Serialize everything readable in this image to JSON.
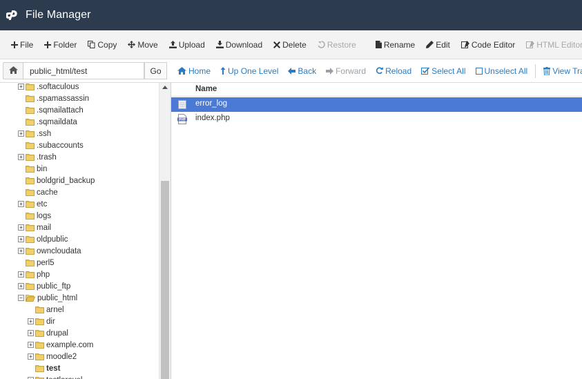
{
  "header": {
    "title": "File Manager",
    "logo_icon": "cpanel-logo-icon"
  },
  "toolbar": {
    "buttons": [
      {
        "label": "File",
        "icon": "plus-icon",
        "disabled": false
      },
      {
        "label": "Folder",
        "icon": "plus-icon",
        "disabled": false
      },
      {
        "label": "Copy",
        "icon": "copy-icon",
        "disabled": false
      },
      {
        "label": "Move",
        "icon": "move-icon",
        "disabled": false
      },
      {
        "label": "Upload",
        "icon": "upload-icon",
        "disabled": false
      },
      {
        "label": "Download",
        "icon": "download-icon",
        "disabled": false
      },
      {
        "label": "Delete",
        "icon": "delete-icon",
        "disabled": false
      },
      {
        "label": "Restore",
        "icon": "restore-icon",
        "disabled": true
      },
      {
        "label": "Rename",
        "icon": "rename-icon",
        "disabled": false
      },
      {
        "label": "Edit",
        "icon": "pencil-icon",
        "disabled": false
      },
      {
        "label": "Code Editor",
        "icon": "code-editor-icon",
        "disabled": false
      },
      {
        "label": "HTML Editor",
        "icon": "html-editor-icon",
        "disabled": true
      }
    ]
  },
  "navbar": {
    "path_value": "public_html/test",
    "go_label": "Go",
    "actions": [
      {
        "label": "Home",
        "icon": "home-icon",
        "disabled": false
      },
      {
        "label": "Up One Level",
        "icon": "level-up-icon",
        "disabled": false
      },
      {
        "label": "Back",
        "icon": "arrow-left-icon",
        "disabled": false
      },
      {
        "label": "Forward",
        "icon": "arrow-right-icon",
        "disabled": true
      },
      {
        "label": "Reload",
        "icon": "reload-icon",
        "disabled": false
      },
      {
        "label": "Select All",
        "icon": "select-all-icon",
        "disabled": false
      },
      {
        "label": "Unselect All",
        "icon": "unselect-all-icon",
        "disabled": false
      },
      {
        "label": "View Trash",
        "icon": "trash-icon",
        "disabled": false
      }
    ]
  },
  "tree": {
    "items": [
      {
        "label": ".softaculous",
        "depth": 0,
        "expander": "plus",
        "bold": false,
        "open": false
      },
      {
        "label": ".spamassassin",
        "depth": 0,
        "expander": "none",
        "bold": false,
        "open": false
      },
      {
        "label": ".sqmailattach",
        "depth": 0,
        "expander": "none",
        "bold": false,
        "open": false
      },
      {
        "label": ".sqmaildata",
        "depth": 0,
        "expander": "none",
        "bold": false,
        "open": false
      },
      {
        "label": ".ssh",
        "depth": 0,
        "expander": "plus",
        "bold": false,
        "open": false
      },
      {
        "label": ".subaccounts",
        "depth": 0,
        "expander": "none",
        "bold": false,
        "open": false
      },
      {
        "label": ".trash",
        "depth": 0,
        "expander": "plus",
        "bold": false,
        "open": false
      },
      {
        "label": "bin",
        "depth": 0,
        "expander": "none",
        "bold": false,
        "open": false
      },
      {
        "label": "boldgrid_backup",
        "depth": 0,
        "expander": "none",
        "bold": false,
        "open": false
      },
      {
        "label": "cache",
        "depth": 0,
        "expander": "none",
        "bold": false,
        "open": false
      },
      {
        "label": "etc",
        "depth": 0,
        "expander": "plus",
        "bold": false,
        "open": false
      },
      {
        "label": "logs",
        "depth": 0,
        "expander": "none",
        "bold": false,
        "open": false
      },
      {
        "label": "mail",
        "depth": 0,
        "expander": "plus",
        "bold": false,
        "open": false
      },
      {
        "label": "oldpublic",
        "depth": 0,
        "expander": "plus",
        "bold": false,
        "open": false
      },
      {
        "label": "owncloudata",
        "depth": 0,
        "expander": "plus",
        "bold": false,
        "open": false
      },
      {
        "label": "perl5",
        "depth": 0,
        "expander": "none",
        "bold": false,
        "open": false
      },
      {
        "label": "php",
        "depth": 0,
        "expander": "plus",
        "bold": false,
        "open": false
      },
      {
        "label": "public_ftp",
        "depth": 0,
        "expander": "plus",
        "bold": false,
        "open": false
      },
      {
        "label": "public_html",
        "depth": 0,
        "expander": "minus",
        "bold": false,
        "open": true
      },
      {
        "label": "arnel",
        "depth": 1,
        "expander": "none",
        "bold": false,
        "open": false
      },
      {
        "label": "dir",
        "depth": 1,
        "expander": "plus",
        "bold": false,
        "open": false
      },
      {
        "label": "drupal",
        "depth": 1,
        "expander": "plus",
        "bold": false,
        "open": false
      },
      {
        "label": "example.com",
        "depth": 1,
        "expander": "plus",
        "bold": false,
        "open": false
      },
      {
        "label": "moodle2",
        "depth": 1,
        "expander": "plus",
        "bold": false,
        "open": false
      },
      {
        "label": "test",
        "depth": 1,
        "expander": "none",
        "bold": true,
        "open": false
      },
      {
        "label": "testlaravel",
        "depth": 1,
        "expander": "plus",
        "bold": false,
        "open": false
      }
    ]
  },
  "files": {
    "column_name": "Name",
    "rows": [
      {
        "name": "error_log",
        "icon": "text-file-icon",
        "selected": true
      },
      {
        "name": "index.php",
        "icon": "php-file-icon",
        "selected": false
      }
    ]
  },
  "colors": {
    "header_bg": "#2d3b4e",
    "link": "#2a7bbf",
    "selected_row": "#4b79d6",
    "folder": "#e8c14b"
  }
}
